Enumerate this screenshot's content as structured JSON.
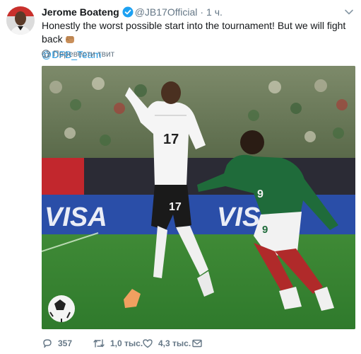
{
  "tweet": {
    "author_name": "Jerome Boateng",
    "handle": "@JB17Official",
    "separator": "·",
    "time": "1 ч.",
    "text": "Honestly the worst possible start into the tournament! But we will fight back",
    "mention": "@DFB_Team",
    "translate_label": "Перевести твит"
  },
  "photo": {
    "ad_text": "VISA",
    "player1_number": "17",
    "player2_number": "9"
  },
  "actions": {
    "replies": "357",
    "retweets": "1,0 тыс.",
    "likes": "4,3 тыс."
  },
  "colors": {
    "link": "#1b95e0",
    "muted": "#657786",
    "verified": "#1da1f2",
    "pitch": "#4b8f3a"
  },
  "icons": [
    "verified-badge-icon",
    "chevron-down-icon",
    "raised-fist-emoji",
    "globe-icon",
    "reply-icon",
    "retweet-icon",
    "like-icon",
    "direct-message-icon"
  ]
}
